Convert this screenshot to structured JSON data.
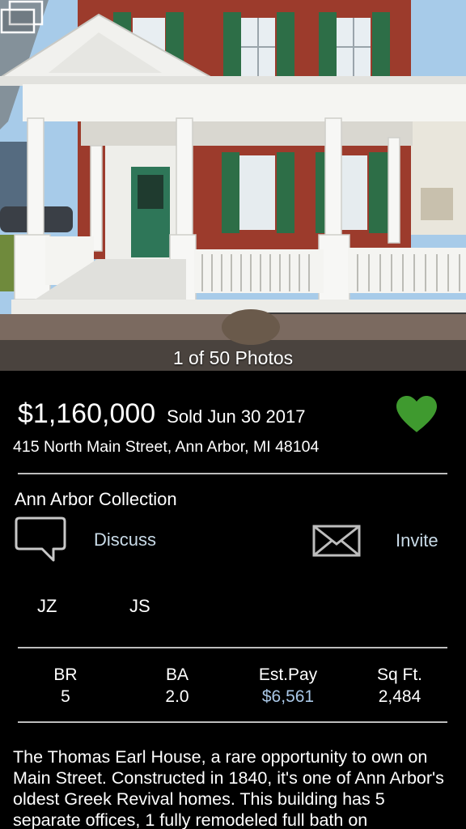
{
  "photo": {
    "counter": "1 of 50 Photos",
    "gallery_icon": "gallery-icon"
  },
  "listing": {
    "price": "$1,160,000",
    "sold": "Sold Jun 30 2017",
    "address": "415 North Main Street, Ann Arbor, MI 48104",
    "favorite_icon": "heart-icon",
    "favorite_color": "#3f9a2f"
  },
  "collection": {
    "name": "Ann Arbor Collection",
    "discuss_label": "Discuss",
    "invite_label": "Invite",
    "members": [
      "JZ",
      "JS"
    ]
  },
  "stats": [
    {
      "label": "BR",
      "value": "5"
    },
    {
      "label": "BA",
      "value": "2.0"
    },
    {
      "label": "Est.Pay",
      "value": "$6,561"
    },
    {
      "label": "Sq Ft.",
      "value": "2,484"
    }
  ],
  "description": "The Thomas Earl House, a rare opportunity to own on Main Street. Constructed in 1840, it's one of Ann Arbor's oldest Greek Revival homes. This building has 5 separate offices, 1 fully remodeled full bath on",
  "colors": {
    "link": "#c9dbe8",
    "accent": "#3f9a2f"
  }
}
